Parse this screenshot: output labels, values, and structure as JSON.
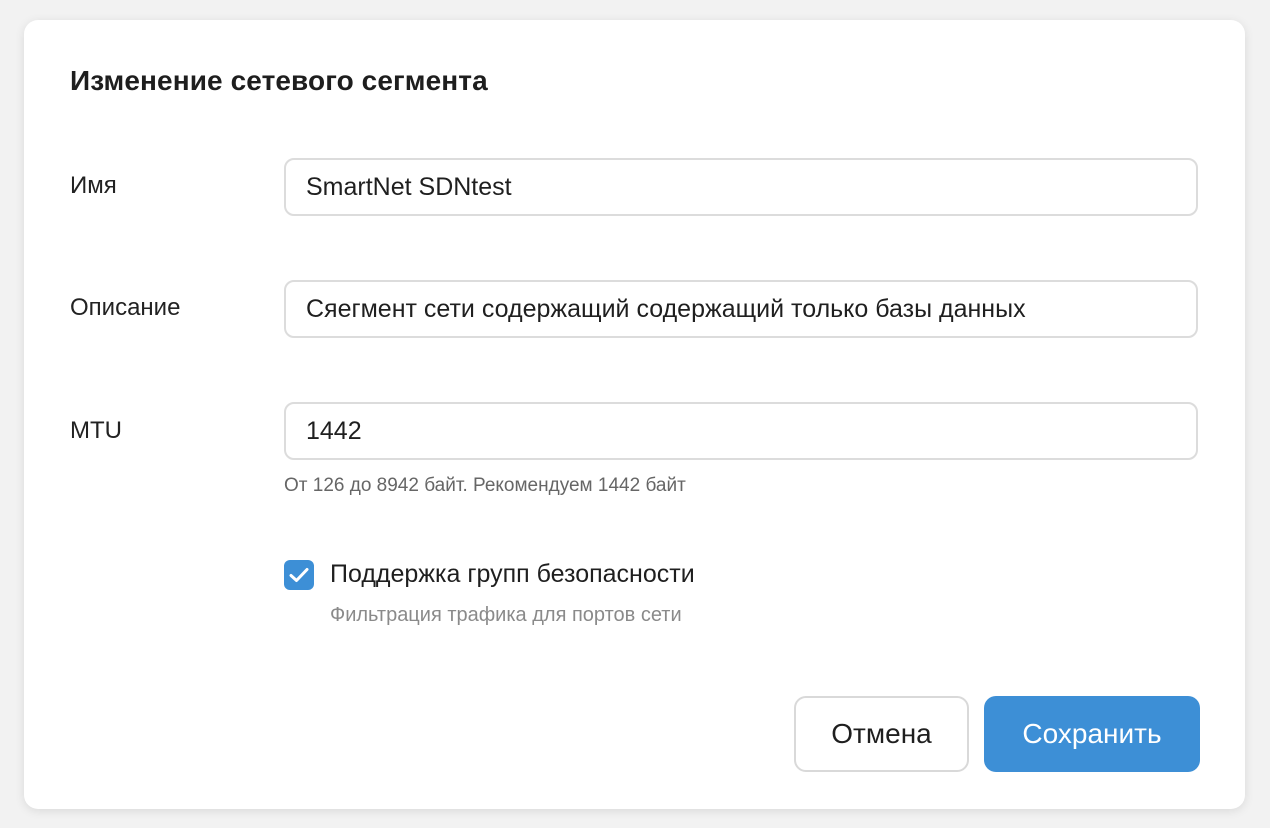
{
  "dialog": {
    "title": "Изменение сетевого сегмента"
  },
  "form": {
    "name": {
      "label": "Имя",
      "value": "SmartNet SDNtest"
    },
    "description": {
      "label": "Описание",
      "value": "Сяегмент сети содержащий содержащий только базы данных"
    },
    "mtu": {
      "label": "MTU",
      "value": "1442",
      "hint": "От 126 до 8942 байт. Рекомендуем 1442 байт"
    },
    "security_groups": {
      "checked": true,
      "label": "Поддержка групп безопасности",
      "description": "Фильтрация трафика для портов сети",
      "icon": "checkmark-icon"
    }
  },
  "actions": {
    "cancel_label": "Отмена",
    "save_label": "Сохранить"
  },
  "colors": {
    "accent": "#3d8fd6",
    "border": "#dcdcdc",
    "hint_text": "#666666",
    "muted_text": "#8a8a8a"
  }
}
